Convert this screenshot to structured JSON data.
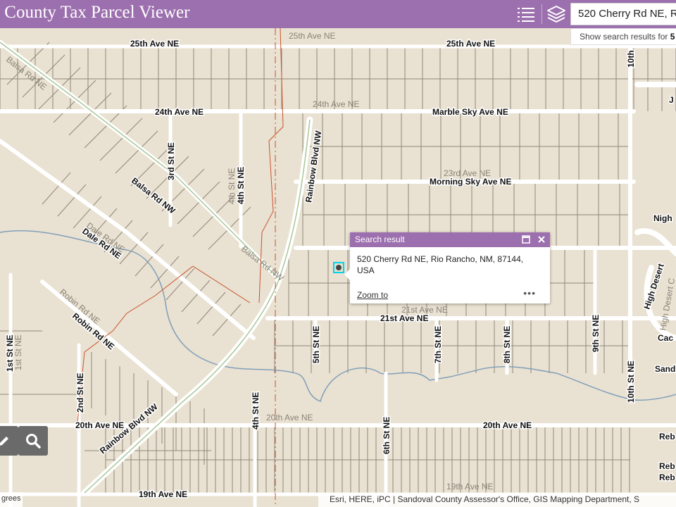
{
  "header": {
    "title": "al County Tax Parcel Viewer",
    "list_icon": "list-icon",
    "layers_icon": "layers-icon"
  },
  "search": {
    "value": "520 Cherry Rd NE, R",
    "hint_prefix": "Show search results for ",
    "hint_bold": "5"
  },
  "popup": {
    "title": "Search result",
    "address": "520 Cherry Rd NE, Rio Rancho, NM, 87144, USA",
    "zoom_label": "Zoom to",
    "more_label": "•••"
  },
  "map": {
    "labels": {
      "ave25": "25th Ave NE",
      "ave25_b": "25th Ave NE",
      "ave25_light": "25th Ave NE",
      "ave24": "24th Ave NE",
      "ave24_light": "24th Ave NE",
      "marble_sky": "Marble Sky Ave NE",
      "ave23_light": "23rd Ave NE",
      "morning_sky": "Morning Sky Ave NE",
      "ave21": "21st Ave NE",
      "ave21_light": "21st Ave NE",
      "ave20": "20th Ave NE",
      "ave20_b": "20th Ave NE",
      "ave20_light": "20th Ave NE",
      "ave19": "19th Ave NE",
      "ave19_light": "19th Ave NE",
      "rainbow_nw": "Rainbow Blvd NW",
      "rainbow_ne": "Rainbow Blvd NW",
      "st3": "3rd St NE",
      "st4": "4th St NE",
      "st4_light": "4th St NE",
      "st4_b": "4th St NE",
      "st5": "5th St NE",
      "st6": "6th St NE",
      "st7": "7th St NE",
      "st8": "8th St NE",
      "st9": "9th St NE",
      "st10": "10th St NE",
      "st10_top": "10th",
      "st1": "1st St NE",
      "st1_light": "1st St NE",
      "st2": "2nd St NE",
      "balsa_light": "Balsa Rd NE",
      "balsa": "Balsa Rd NW",
      "balsa_light2": "Balsa Rd NW",
      "dale": "Dale Rd NE",
      "dale_light": "Dale Rd NE",
      "robin": "Robin Rd NE",
      "robin_light": "Robin Rd NE",
      "high_desert": "High Desert",
      "high_desert_light": "High Desert C",
      "night": "Nigh",
      "j": "J",
      "cac": "Cac",
      "sand": "Sand",
      "reb": "Reb",
      "reb2": "Reb",
      "reb3": "Reb"
    }
  },
  "attribution": "Esri, HERE, iPC | Sandoval County Assessor's Office, GIS Mapping Department, S",
  "coords_text": "grees",
  "colors": {
    "header": "#9c6fae",
    "map_bg": "#e9e1d1",
    "road": "#ffffff",
    "parcel_line": "#8e877a",
    "boundary": "#c8532e",
    "stream": "#7a9bb8"
  }
}
